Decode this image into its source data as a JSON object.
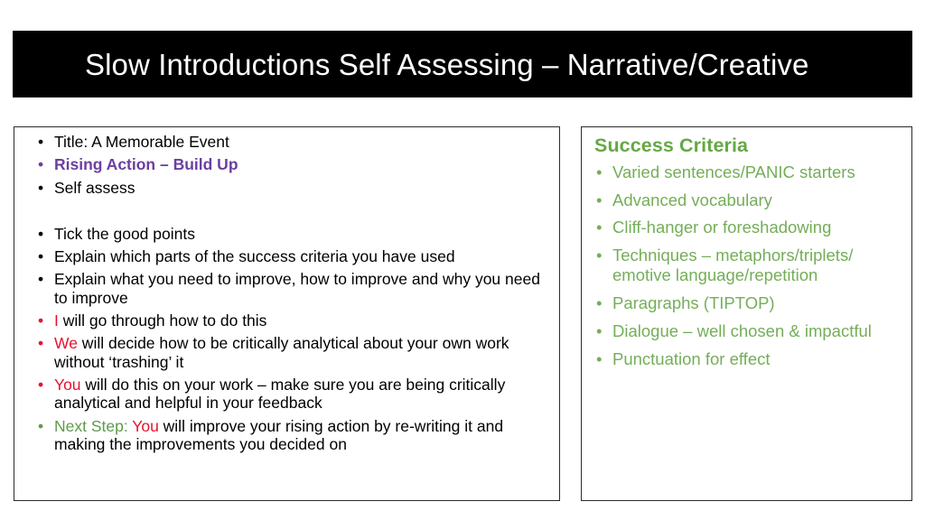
{
  "slide": {
    "background_color": "#FFFFFF",
    "title": {
      "text": "Slow Introductions Self Assessing – Narrative/Creative",
      "background_color": "#000000",
      "text_color": "#FFFFFF"
    },
    "colors": {
      "black": "#000000",
      "red": "#E8112D",
      "green": "#5E9B4B",
      "light_green": "#74AE58",
      "heading_green": "#66A844",
      "purple": "#6B3FA0",
      "border": "#2B2B2B"
    }
  },
  "left_box": {
    "bullets": [
      {
        "bullet_color": "#000000",
        "runs": [
          {
            "text": "Title: A Memorable Event",
            "color": "black"
          }
        ]
      },
      {
        "bullet_color": "#6B3FA0",
        "runs": [
          {
            "text": "Rising Action – Build Up",
            "color": "purple"
          }
        ]
      },
      {
        "bullet_color": "#000000",
        "runs": [
          {
            "text": "Self assess",
            "color": "black"
          }
        ]
      },
      {
        "spacer": true
      },
      {
        "bullet_color": "#000000",
        "runs": [
          {
            "text": "Tick the good points",
            "color": "black"
          }
        ]
      },
      {
        "bullet_color": "#000000",
        "runs": [
          {
            "text": "Explain which parts of the success criteria you have used",
            "color": "black"
          }
        ]
      },
      {
        "bullet_color": "#000000",
        "runs": [
          {
            "text": "Explain what you need to improve, how to improve and why you need to improve",
            "color": "black"
          }
        ]
      },
      {
        "bullet_color": "#E8112D",
        "runs": [
          {
            "text": "I",
            "color": "red"
          },
          {
            "text": " will go through how to do this",
            "color": "black"
          }
        ]
      },
      {
        "bullet_color": "#E8112D",
        "runs": [
          {
            "text": "We",
            "color": "red"
          },
          {
            "text": " will decide how to be critically analytical about your own work without ‘trashing’ it",
            "color": "black"
          }
        ]
      },
      {
        "bullet_color": "#E8112D",
        "runs": [
          {
            "text": "You",
            "color": "red"
          },
          {
            "text": " will do this on your work – make sure you are being critically analytical and helpful in your feedback",
            "color": "black"
          }
        ]
      },
      {
        "bullet_color": "#5E9B4B",
        "runs": [
          {
            "text": "Next Step: ",
            "color": "green"
          },
          {
            "text": "You",
            "color": "red"
          },
          {
            "text": " will improve your rising action by re-writing it and making the improvements you decided on",
            "color": "black"
          }
        ]
      }
    ]
  },
  "right_box": {
    "heading": "Success Criteria",
    "bullets": [
      {
        "text": "Varied sentences/PANIC starters"
      },
      {
        "text": "Advanced vocabulary"
      },
      {
        "text": "Cliff-hanger or foreshadowing"
      },
      {
        "text": "Techniques – metaphors/triplets/ emotive language/repetition"
      },
      {
        "text": "Paragraphs (TIPTOP)"
      },
      {
        "text": "Dialogue – well chosen & impactful"
      },
      {
        "text": "Punctuation for effect"
      }
    ]
  }
}
